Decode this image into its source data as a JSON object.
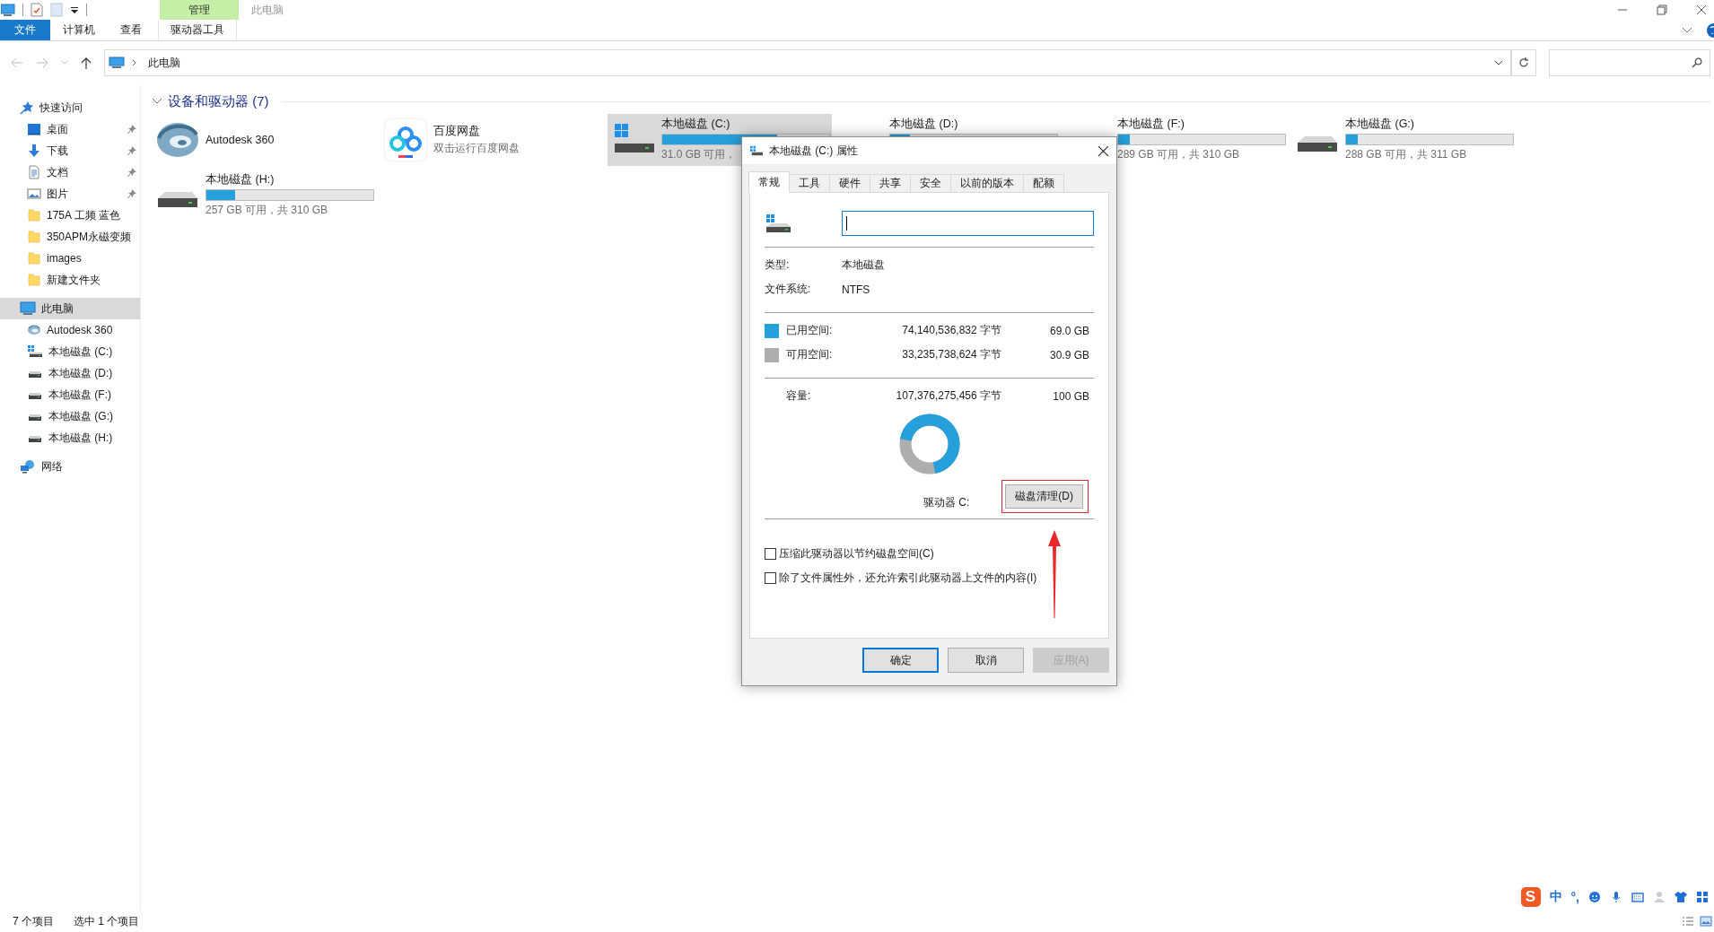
{
  "window": {
    "title": "此电脑",
    "context_group": "管理"
  },
  "ribbon": {
    "tabs": [
      {
        "label": "文件",
        "kind": "file"
      },
      {
        "label": "计算机",
        "kind": "tab"
      },
      {
        "label": "查看",
        "kind": "tab"
      },
      {
        "label": "驱动器工具",
        "kind": "context"
      }
    ]
  },
  "address_bar": {
    "path": "此电脑"
  },
  "sidebar": {
    "items": [
      {
        "label": "快速访问",
        "kind": "quick-access",
        "selected": false,
        "children": [
          {
            "label": "桌面",
            "kind": "desktop",
            "selected": false,
            "pinned": true
          },
          {
            "label": "下载",
            "kind": "downloads",
            "selected": false,
            "pinned": true
          },
          {
            "label": "文档",
            "kind": "documents",
            "selected": false,
            "pinned": true
          },
          {
            "label": "图片",
            "kind": "pictures",
            "selected": false,
            "pinned": true
          },
          {
            "label": "175A 工频 蓝色",
            "kind": "folder",
            "selected": false,
            "pinned": false
          },
          {
            "label": "350APM永磁变频",
            "kind": "folder",
            "selected": false,
            "pinned": false
          },
          {
            "label": "images",
            "kind": "folder",
            "selected": false,
            "pinned": false
          },
          {
            "label": "新建文件夹",
            "kind": "folder",
            "selected": false,
            "pinned": false
          }
        ]
      },
      {
        "label": "此电脑",
        "kind": "computer",
        "selected": true,
        "children": [
          {
            "label": "Autodesk 360",
            "kind": "app",
            "selected": false
          },
          {
            "label": "本地磁盘 (C:)",
            "kind": "system-drive",
            "selected": false
          },
          {
            "label": "本地磁盘 (D:)",
            "kind": "drive",
            "selected": false
          },
          {
            "label": "本地磁盘 (F:)",
            "kind": "drive",
            "selected": false
          },
          {
            "label": "本地磁盘 (G:)",
            "kind": "drive",
            "selected": false
          },
          {
            "label": "本地磁盘 (H:)",
            "kind": "drive",
            "selected": false
          }
        ]
      },
      {
        "label": "网络",
        "kind": "network",
        "selected": false
      }
    ]
  },
  "content": {
    "group": "设备和驱动器 (7)",
    "items": [
      {
        "kind": "app",
        "name": "Autodesk 360",
        "selected": false
      },
      {
        "kind": "app",
        "name": "百度网盘",
        "subtitle": "双击运行百度网盘",
        "selected": false
      },
      {
        "kind": "system-drive",
        "name": "本地磁盘 (C:)",
        "level": 0.69,
        "free": "31.0 GB 可用，",
        "selected": true
      },
      {
        "kind": "drive",
        "name": "本地磁盘 (D:)",
        "level": 0.12,
        "selected": false
      },
      {
        "kind": "drive",
        "name": "本地磁盘 (F:)",
        "level": 0.07,
        "free": "289 GB 可用，共 310 GB",
        "selected": false
      },
      {
        "kind": "drive",
        "name": "本地磁盘 (G:)",
        "level": 0.07,
        "free": "288 GB 可用，共 311 GB",
        "selected": false
      },
      {
        "kind": "drive",
        "name": "本地磁盘 (H:)",
        "level": 0.17,
        "free": "257 GB 可用，共 310 GB",
        "selected": false
      }
    ]
  },
  "dialog": {
    "title": "本地磁盘 (C:) 属性",
    "tabs": [
      {
        "label": "常规",
        "selected": true
      },
      {
        "label": "工具",
        "selected": false
      },
      {
        "label": "硬件",
        "selected": false
      },
      {
        "label": "共享",
        "selected": false
      },
      {
        "label": "安全",
        "selected": false
      },
      {
        "label": "以前的版本",
        "selected": false
      },
      {
        "label": "配额",
        "selected": false
      }
    ],
    "name_field": {
      "focused": true
    },
    "info": [
      {
        "label": "类型:",
        "value": "本地磁盘"
      },
      {
        "label": "文件系统:",
        "value": "NTFS"
      }
    ],
    "spaces": [
      {
        "label": "已用空间:",
        "bytes": "74,140,536,832 字节",
        "size": "69.0 GB",
        "color": "#26a0da"
      },
      {
        "label": "可用空间:",
        "bytes": "33,235,738,624 字节",
        "size": "30.9 GB",
        "color": "#aeaeae"
      }
    ],
    "capacity": {
      "label": "容量:",
      "bytes": "107,376,275,456 字节",
      "size": "100 GB"
    },
    "usage_ring": {
      "level": 0.69
    },
    "drive_label": "驱动器 C:",
    "cleanup_button": {
      "label": "磁盘清理(D)",
      "highlighted": true
    },
    "options": [
      {
        "label": "压缩此驱动器以节约磁盘空间(C)",
        "checked": false
      },
      {
        "label": "除了文件属性外，还允许索引此驱动器上文件的内容(I)",
        "checked": false
      }
    ],
    "buttons": [
      {
        "label": "确定",
        "kind": "default"
      },
      {
        "label": "取消",
        "kind": "normal"
      },
      {
        "label": "应用(A)",
        "kind": "disabled"
      }
    ]
  },
  "status_bar": {
    "count": "7 个项目",
    "selection": "选中 1 个项目"
  },
  "ime_toolbar": {
    "logo": "S",
    "mode": "中",
    "punctuation": "°,"
  }
}
